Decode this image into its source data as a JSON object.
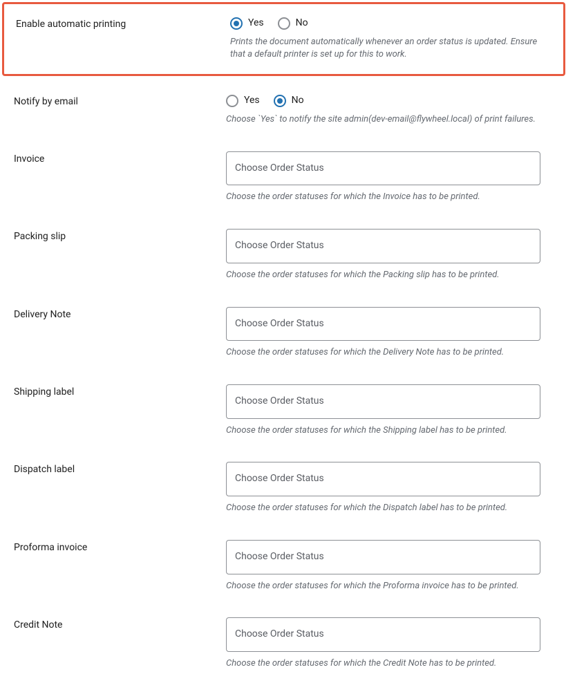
{
  "settings": {
    "autoPrint": {
      "label": "Enable automatic printing",
      "options": {
        "yes": "Yes",
        "no": "No"
      },
      "selected": "yes",
      "help": "Prints the document automatically whenever an order status is updated. Ensure that a default printer is set up for this to work."
    },
    "notifyEmail": {
      "label": "Notify by email",
      "options": {
        "yes": "Yes",
        "no": "No"
      },
      "selected": "no",
      "help": "Choose `Yes` to notify the site admin(dev-email@flywheel.local) of print failures."
    },
    "invoice": {
      "label": "Invoice",
      "placeholder": "Choose Order Status",
      "help": "Choose the order statuses for which the Invoice has to be printed."
    },
    "packingSlip": {
      "label": "Packing slip",
      "placeholder": "Choose Order Status",
      "help": "Choose the order statuses for which the Packing slip has to be printed."
    },
    "deliveryNote": {
      "label": "Delivery Note",
      "placeholder": "Choose Order Status",
      "help": "Choose the order statuses for which the Delivery Note has to be printed."
    },
    "shippingLabel": {
      "label": "Shipping label",
      "placeholder": "Choose Order Status",
      "help": "Choose the order statuses for which the Shipping label has to be printed."
    },
    "dispatchLabel": {
      "label": "Dispatch label",
      "placeholder": "Choose Order Status",
      "help": "Choose the order statuses for which the Dispatch label has to be printed."
    },
    "proformaInvoice": {
      "label": "Proforma invoice",
      "placeholder": "Choose Order Status",
      "help": "Choose the order statuses for which the Proforma invoice has to be printed."
    },
    "creditNote": {
      "label": "Credit Note",
      "placeholder": "Choose Order Status",
      "help": "Choose the order statuses for which the Credit Note has to be printed."
    }
  }
}
